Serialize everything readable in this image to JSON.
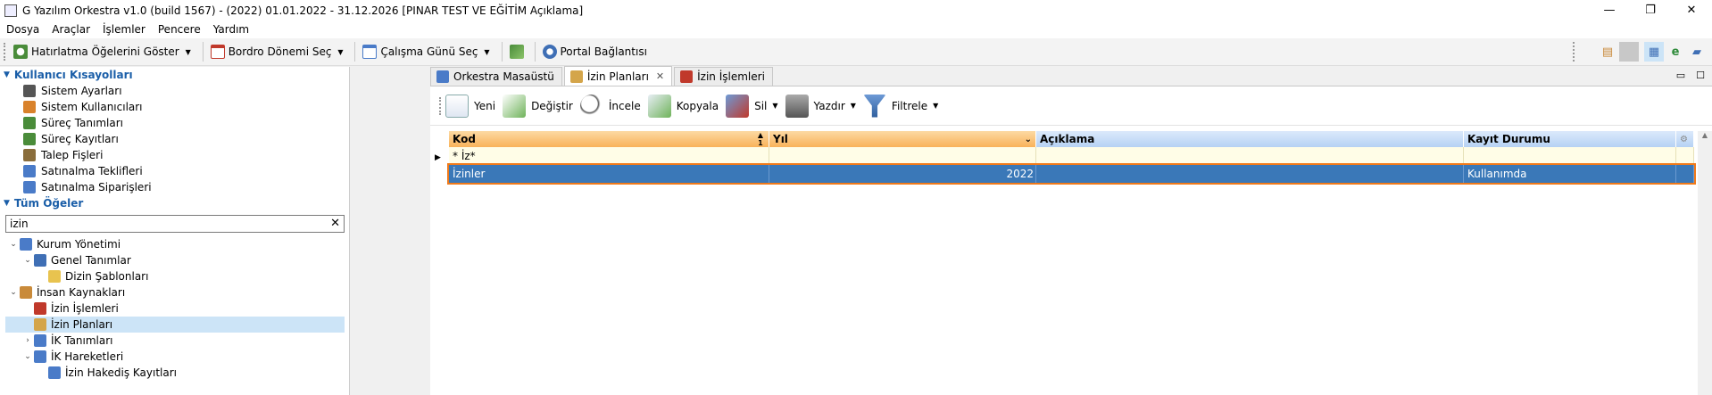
{
  "window": {
    "title": "G Yazılım Orkestra v1.0 (build 1567) - (2022) 01.01.2022 - 31.12.2026 [PINAR TEST VE EĞİTİM Açıklama]",
    "controls": {
      "minimize": "—",
      "restore": "❐",
      "close": "✕"
    }
  },
  "menu": [
    "Dosya",
    "Araçlar",
    "İşlemler",
    "Pencere",
    "Yardım"
  ],
  "toolbar": {
    "reminders": "Hatırlatma Öğelerini Göster",
    "payroll": "Bordro Dönemi Seç",
    "workday": "Çalışma Günü Seç",
    "portal": "Portal Bağlantısı"
  },
  "shortcuts": {
    "title": "Kullanıcı Kısayolları",
    "items": [
      {
        "label": "Sistem Ayarları",
        "icon": "gear-icon",
        "color": "#555555"
      },
      {
        "label": "Sistem Kullanıcıları",
        "icon": "users-icon",
        "color": "#d9822b"
      },
      {
        "label": "Süreç Tanımları",
        "icon": "process-icon",
        "color": "#4a8c3a"
      },
      {
        "label": "Süreç Kayıtları",
        "icon": "process-records-icon",
        "color": "#4a8c3a"
      },
      {
        "label": "Talep Fişleri",
        "icon": "request-icon",
        "color": "#8a6d3b"
      },
      {
        "label": "Satınalma Teklifleri",
        "icon": "quote-icon",
        "color": "#4a7bc8"
      },
      {
        "label": "Satınalma Siparişleri",
        "icon": "order-icon",
        "color": "#4a7bc8"
      }
    ]
  },
  "all_items": {
    "title": "Tüm Öğeler",
    "search_value": "izin",
    "clear": "✕",
    "tree": [
      {
        "label": "Kurum Yönetimi",
        "level": 0,
        "toggle": "⌄",
        "icon": "organization-icon",
        "color": "#4a7bc8",
        "selected": false
      },
      {
        "label": "Genel Tanımlar",
        "level": 1,
        "toggle": "⌄",
        "icon": "definitions-icon",
        "color": "#3f6fb5",
        "selected": false
      },
      {
        "label": "Dizin Şablonları",
        "level": 2,
        "toggle": "",
        "icon": "folder-icon",
        "color": "#e8c34f",
        "selected": false
      },
      {
        "label": "İnsan Kaynakları",
        "level": 0,
        "toggle": "⌄",
        "icon": "hr-icon",
        "color": "#c98a3a",
        "selected": false
      },
      {
        "label": "İzin İşlemleri",
        "level": 1,
        "toggle": "",
        "icon": "calendar-icon",
        "color": "#c0392b",
        "selected": false
      },
      {
        "label": "İzin Planları",
        "level": 1,
        "toggle": "",
        "icon": "plan-icon",
        "color": "#d4a54a",
        "selected": true
      },
      {
        "label": "İK Tanımları",
        "level": 1,
        "toggle": "›",
        "icon": "table-icon",
        "color": "#4a7bc8",
        "selected": false
      },
      {
        "label": "İK Hareketleri",
        "level": 1,
        "toggle": "⌄",
        "icon": "table-icon",
        "color": "#4a7bc8",
        "selected": false
      },
      {
        "label": "İzin Hakediş Kayıtları",
        "level": 2,
        "toggle": "",
        "icon": "table-icon",
        "color": "#4a7bc8",
        "selected": false
      }
    ]
  },
  "tabs": [
    {
      "label": "Orkestra Masaüstü",
      "icon": "desktop-icon",
      "color": "#4a7bc8",
      "active": false,
      "closable": false
    },
    {
      "label": "İzin Planları",
      "icon": "plan-icon",
      "color": "#d4a54a",
      "active": true,
      "closable": true
    },
    {
      "label": "İzin İşlemleri",
      "icon": "calendar-icon",
      "color": "#c0392b",
      "active": false,
      "closable": false
    }
  ],
  "actions": {
    "new": "Yeni",
    "edit": "Değiştir",
    "inspect": "İncele",
    "copy": "Kopyala",
    "delete": "Sil",
    "print": "Yazdır",
    "filter": "Filtrele"
  },
  "grid": {
    "columns": [
      "Kod",
      "Yıl",
      "Açıklama",
      "Kayıt Durumu"
    ],
    "sort_indicator": "1",
    "filter_row": [
      "* İz*",
      "",
      "",
      ""
    ],
    "rows": [
      [
        "İzinler",
        "2022",
        "",
        "Kullanımda"
      ]
    ]
  },
  "colors": {
    "accent": "#1a5ea8",
    "selection": "#3a78b8",
    "header_orange": "#f9b25a",
    "highlight": "#f07a1a"
  }
}
